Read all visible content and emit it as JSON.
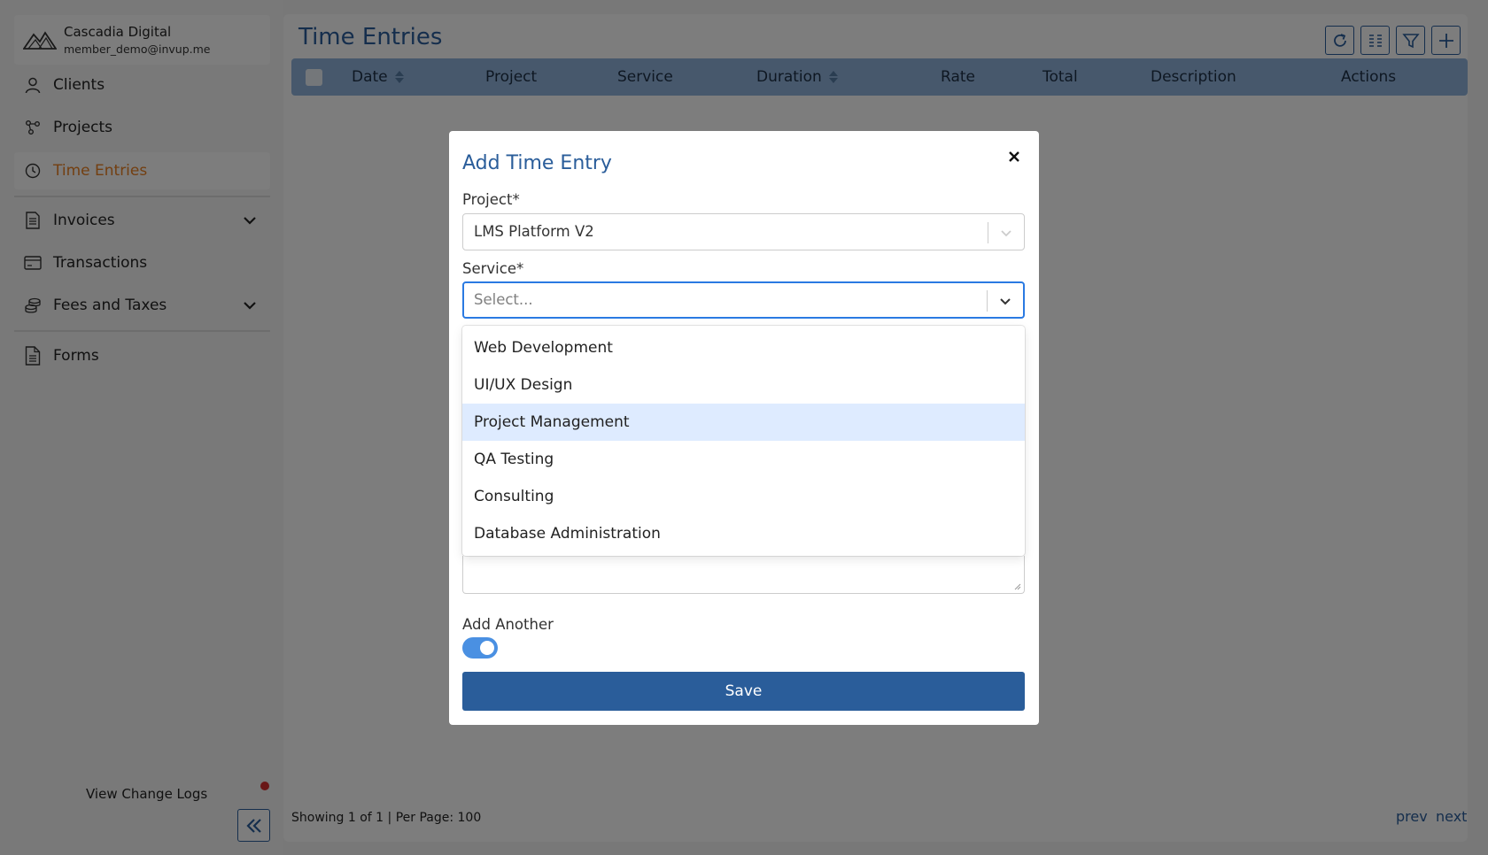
{
  "sidebar": {
    "org_name": "Cascadia Digital",
    "org_email": "member_demo@invup.me",
    "items": [
      {
        "label": "Clients",
        "icon": "user-icon"
      },
      {
        "label": "Projects",
        "icon": "nodes-icon"
      },
      {
        "label": "Time Entries",
        "icon": "clock-icon",
        "active": true
      },
      {
        "label": "Invoices",
        "icon": "invoice-icon",
        "expandable": true
      },
      {
        "label": "Transactions",
        "icon": "card-icon"
      },
      {
        "label": "Fees and Taxes",
        "icon": "coins-icon",
        "expandable": true
      },
      {
        "label": "Forms",
        "icon": "document-icon"
      }
    ],
    "change_logs": "View Change Logs",
    "active_color": "#e67e22"
  },
  "main": {
    "title": "Time Entries",
    "toolbar": [
      "refresh-icon",
      "columns-icon",
      "filter-icon",
      "plus-icon"
    ],
    "columns": [
      "Date",
      "Project",
      "Service",
      "Duration",
      "Rate",
      "Total",
      "Description",
      "Actions"
    ],
    "footer": "Showing 1 of 1 | Per Page: 100",
    "prev": "prev",
    "next": "next",
    "accent": "#2a5d9a"
  },
  "modal": {
    "title": "Add Time Entry",
    "project_label": "Project*",
    "project_value": "LMS Platform V2",
    "service_label": "Service*",
    "service_placeholder": "Select...",
    "service_options": [
      "Web Development",
      "UI/UX Design",
      "Project Management",
      "QA Testing",
      "Consulting",
      "Database Administration"
    ],
    "highlighted_option": "Project Management",
    "add_another_label": "Add Another",
    "add_another_on": true,
    "save_label": "Save"
  }
}
